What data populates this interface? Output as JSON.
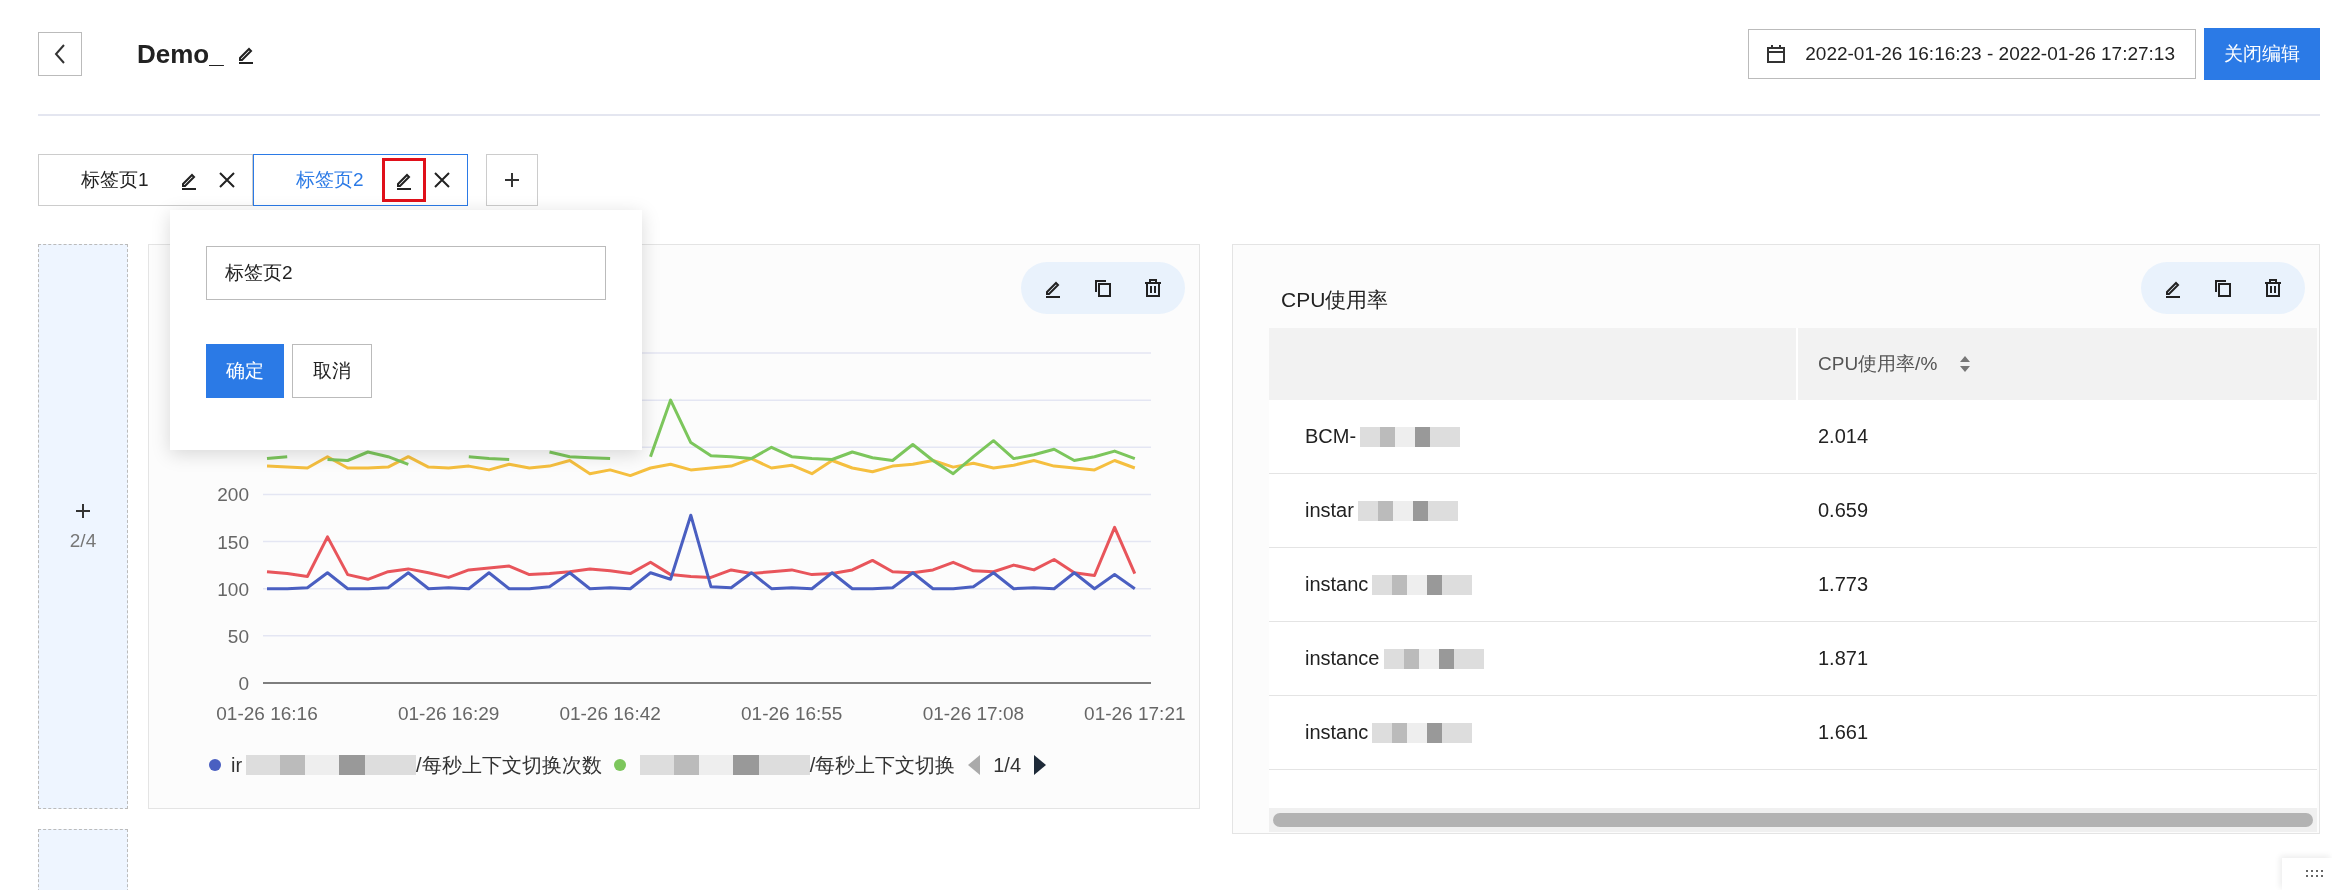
{
  "header": {
    "title": "Demo_",
    "date_range": "2022-01-26 16:16:23 - 2022-01-26 17:27:13",
    "close_edit_button": "关闭编辑"
  },
  "tabs": [
    {
      "label": "标签页1",
      "selected": false,
      "edit_highlighted": false
    },
    {
      "label": "标签页2",
      "selected": true,
      "edit_highlighted": true
    }
  ],
  "side_slots": [
    {
      "kind": "labeled",
      "page": "2/4"
    },
    {
      "kind": "empty"
    }
  ],
  "rename_popup": {
    "value": "标签页2",
    "confirm": "确定",
    "cancel": "取消"
  },
  "chart_panel": {
    "chart_data": {
      "type": "line",
      "categories": [
        "01-26 16:16",
        null,
        null,
        null,
        null,
        null,
        null,
        null,
        null,
        "01-26 16:29",
        null,
        null,
        null,
        null,
        null,
        null,
        null,
        "01-26 16:42",
        null,
        null,
        null,
        null,
        null,
        null,
        null,
        null,
        "01-26 16:55",
        null,
        null,
        null,
        null,
        null,
        null,
        null,
        null,
        "01-26 17:08",
        null,
        null,
        null,
        null,
        null,
        null,
        null,
        "01-26 17:21"
      ],
      "ylim": [
        0,
        350
      ],
      "yticks": [
        0,
        50,
        100,
        150,
        200
      ],
      "grid": true,
      "series": [
        {
          "color": "#f5bf3f",
          "values": [
            230,
            229,
            228,
            240,
            228,
            228,
            229,
            240,
            229,
            228,
            230,
            226,
            232,
            228,
            230,
            236,
            222,
            226,
            220,
            228,
            232,
            226,
            228,
            230,
            238,
            228,
            231,
            222,
            236,
            228,
            224,
            230,
            232,
            236,
            229,
            233,
            228,
            231,
            236,
            230,
            228,
            226,
            236,
            228
          ]
        },
        {
          "color": "#7cc65c",
          "values": [
            238,
            240,
            null,
            237,
            236,
            245,
            240,
            232,
            null,
            null,
            240,
            238,
            237,
            null,
            245,
            240,
            239,
            238,
            null,
            240,
            300,
            255,
            241,
            240,
            238,
            250,
            240,
            238,
            237,
            245,
            239,
            236,
            253,
            236,
            222,
            240,
            257,
            238,
            242,
            248,
            236,
            240,
            246,
            238
          ]
        },
        {
          "color": "#e8555b",
          "values": [
            118,
            116,
            113,
            155,
            115,
            110,
            118,
            121,
            117,
            112,
            120,
            122,
            124,
            115,
            116,
            118,
            121,
            119,
            116,
            128,
            115,
            113,
            112,
            120,
            116,
            118,
            120,
            115,
            116,
            120,
            130,
            118,
            117,
            120,
            128,
            119,
            118,
            125,
            120,
            131,
            117,
            114,
            165,
            116
          ]
        },
        {
          "color": "#4a5fc1",
          "values": [
            100,
            100,
            101,
            117,
            100,
            100,
            101,
            117,
            100,
            101,
            100,
            117,
            100,
            100,
            102,
            117,
            100,
            101,
            100,
            117,
            110,
            178,
            102,
            101,
            117,
            100,
            101,
            100,
            117,
            100,
            100,
            101,
            117,
            100,
            100,
            102,
            117,
            100,
            101,
            100,
            117,
            100,
            115,
            100
          ]
        }
      ]
    },
    "legend": {
      "items": [
        {
          "color": "#4a5fc1",
          "prefix": "ir",
          "suffix": "/每秒上下文切换次数"
        },
        {
          "color": "#7cc65c",
          "suffix": "/每秒上下文切换"
        }
      ],
      "page": "1/4"
    }
  },
  "table_panel": {
    "title": "CPU使用率",
    "columns": [
      "",
      "CPU使用率/%"
    ],
    "rows": [
      {
        "name": "BCM-",
        "value": "2.014"
      },
      {
        "name": "instar",
        "value": "0.659"
      },
      {
        "name": "instanc",
        "value": "1.773"
      },
      {
        "name": "instance",
        "value": "1.871"
      },
      {
        "name": "instanc",
        "value": "1.661"
      }
    ]
  }
}
